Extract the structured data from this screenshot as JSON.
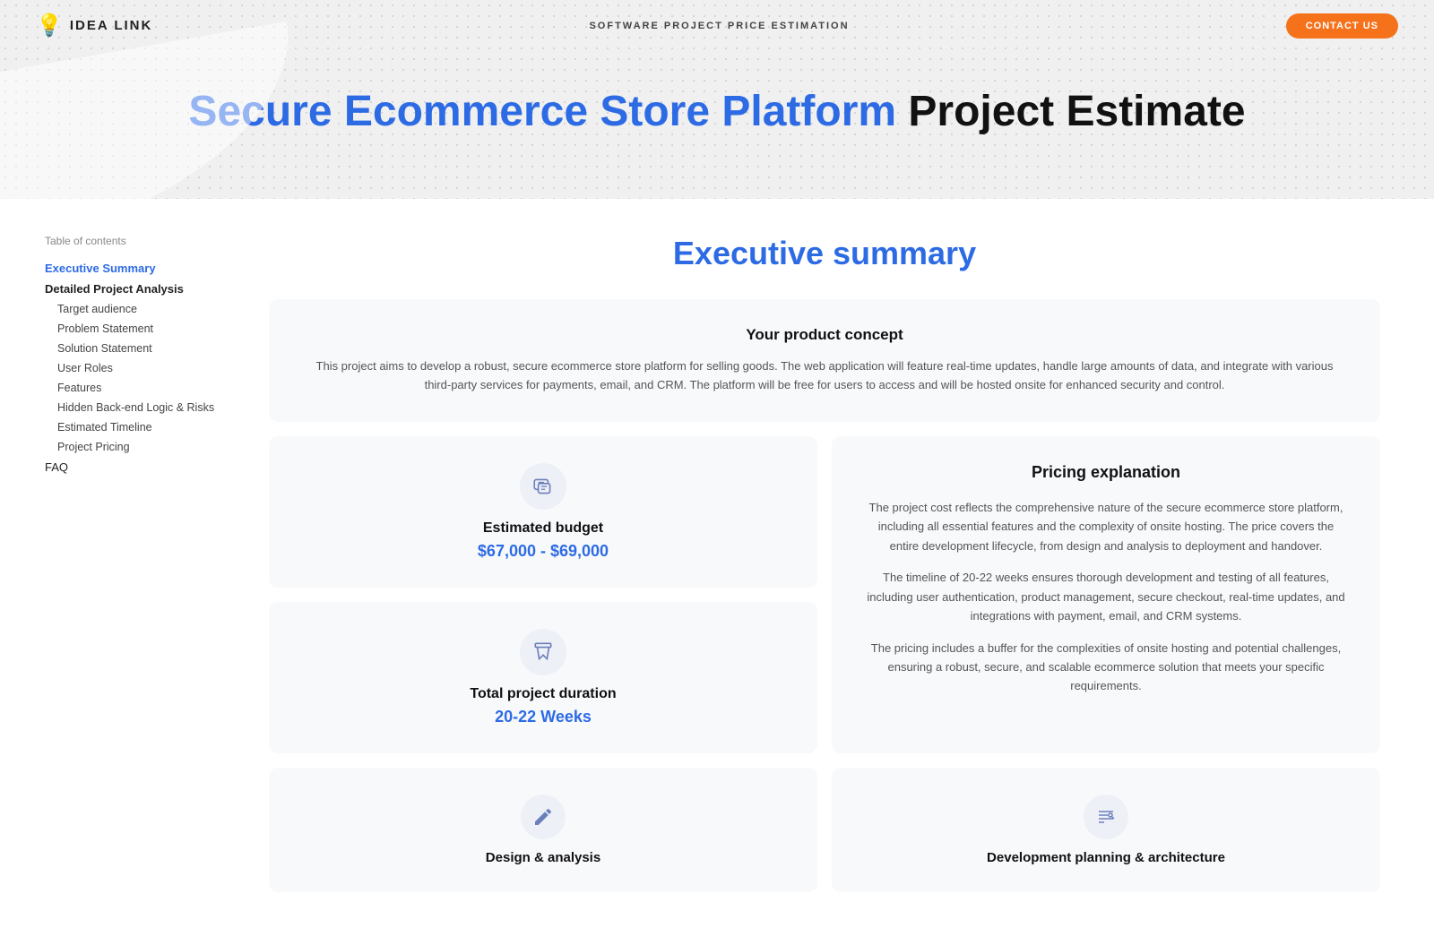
{
  "header": {
    "logo_icon": "💡",
    "logo_text": "IDEA LINK",
    "nav_center": "SOFTWARE PROJECT PRICE ESTIMATION",
    "contact_btn": "CONTACT US"
  },
  "hero": {
    "title_blue": "Secure Ecommerce Store Platform",
    "title_black": " Project Estimate"
  },
  "sidebar": {
    "toc_label": "Table of contents",
    "items": [
      {
        "label": "Executive Summary",
        "active": true,
        "sub": false
      },
      {
        "label": "Detailed Project Analysis",
        "active": false,
        "sub": false,
        "bold": true
      },
      {
        "label": "Target audience",
        "active": false,
        "sub": true
      },
      {
        "label": "Problem Statement",
        "active": false,
        "sub": true
      },
      {
        "label": "Solution Statement",
        "active": false,
        "sub": true
      },
      {
        "label": "User Roles",
        "active": false,
        "sub": true
      },
      {
        "label": "Features",
        "active": false,
        "sub": true
      },
      {
        "label": "Hidden Back-end Logic & Risks",
        "active": false,
        "sub": true
      },
      {
        "label": "Estimated Timeline",
        "active": false,
        "sub": true
      },
      {
        "label": "Project Pricing",
        "active": false,
        "sub": true
      },
      {
        "label": "FAQ",
        "active": false,
        "sub": false
      }
    ]
  },
  "main": {
    "section_title": "Executive summary",
    "product_concept": {
      "title": "Your product concept",
      "text": "This project aims to develop a robust, secure ecommerce store platform for selling goods. The web application will feature real-time updates, handle large amounts of data, and integrate with various third-party services for payments, email, and CRM. The platform will be free for users to access and will be hosted onsite for enhanced security and control."
    },
    "estimated_budget": {
      "label": "Estimated budget",
      "value": "$67,000 - $69,000",
      "icon": "📋"
    },
    "total_duration": {
      "label": "Total project duration",
      "value": "20-22 Weeks",
      "icon": "⏳"
    },
    "pricing_explanation": {
      "title": "Pricing explanation",
      "para1": "The project cost reflects the comprehensive nature of the secure ecommerce store platform, including all essential features and the complexity of onsite hosting. The price covers the entire development lifecycle, from design and analysis to deployment and handover.",
      "para2": "The timeline of 20-22 weeks ensures thorough development and testing of all features, including user authentication, product management, secure checkout, real-time updates, and integrations with payment, email, and CRM systems.",
      "para3": "The pricing includes a buffer for the complexities of onsite hosting and potential challenges, ensuring a robust, secure, and scalable ecommerce solution that meets your specific requirements."
    },
    "design_analysis": {
      "label": "Design & analysis",
      "icon": "✏️"
    },
    "dev_planning": {
      "label": "Development planning & architecture",
      "icon": "⚙️"
    }
  }
}
